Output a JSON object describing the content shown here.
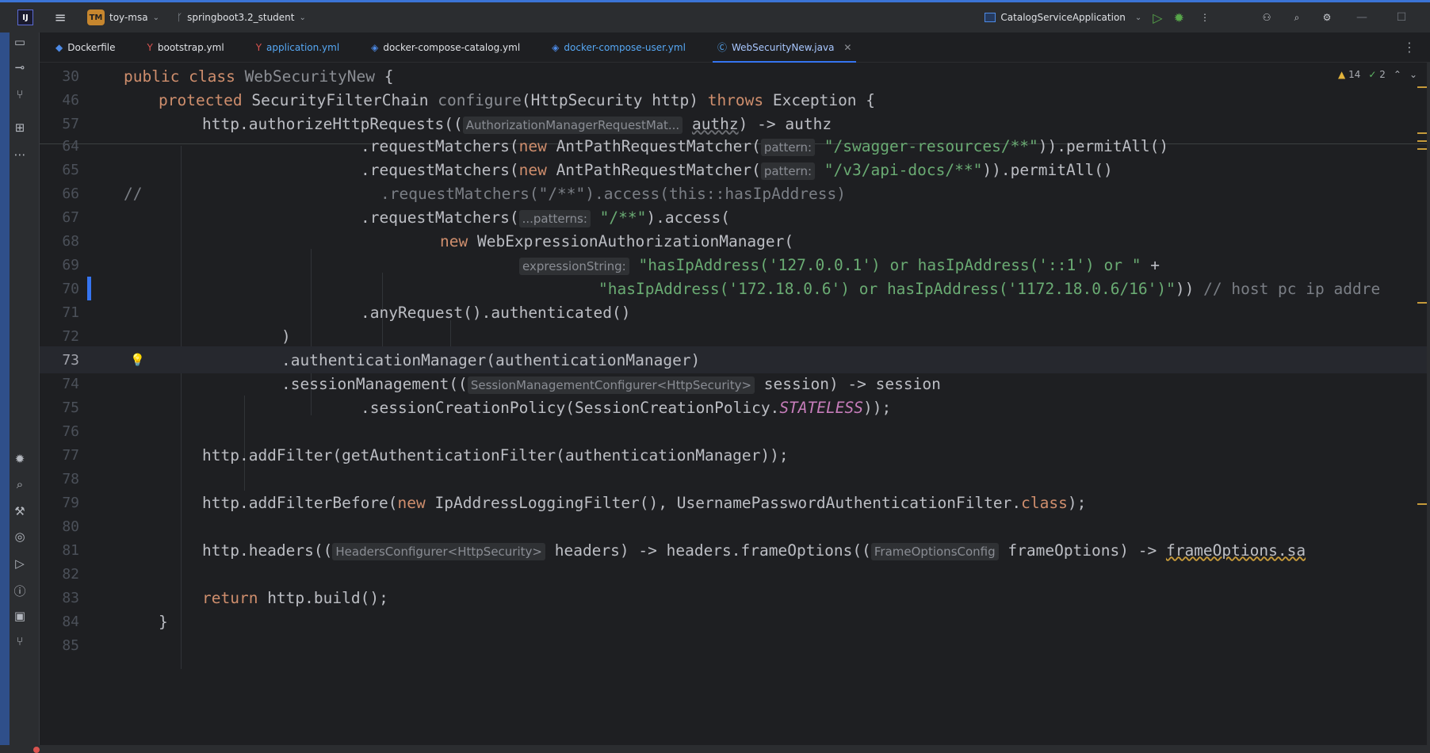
{
  "titlebar": {
    "app_logo": "IJ",
    "project_badge": "TM",
    "project_name": "toy-msa",
    "branch_name": "springboot3.2_student",
    "run_config": "CatalogServiceApplication"
  },
  "tabs": [
    {
      "label": "Dockerfile",
      "icon": "docker-icon",
      "color": "#bcbec4"
    },
    {
      "label": "bootstrap.yml",
      "icon": "yaml-icon",
      "color": "#bcbec4"
    },
    {
      "label": "application.yml",
      "icon": "yaml-icon",
      "color": "#56a8f5"
    },
    {
      "label": "docker-compose-catalog.yml",
      "icon": "docker-compose-icon",
      "color": "#bcbec4"
    },
    {
      "label": "docker-compose-user.yml",
      "icon": "docker-compose-icon",
      "color": "#56a8f5"
    },
    {
      "label": "WebSecurityNew.java",
      "icon": "java-class-icon",
      "color": "#a8c7ff",
      "active": true
    }
  ],
  "inspections": {
    "warnings": "14",
    "weak_warnings": "2"
  },
  "editor": {
    "lines": [
      {
        "n": "30"
      },
      {
        "n": "46"
      },
      {
        "n": "57"
      },
      {
        "n": "64"
      },
      {
        "n": "65"
      },
      {
        "n": "66"
      },
      {
        "n": "67"
      },
      {
        "n": "68"
      },
      {
        "n": "69"
      },
      {
        "n": "70"
      },
      {
        "n": "71"
      },
      {
        "n": "72"
      },
      {
        "n": "73"
      },
      {
        "n": "74"
      },
      {
        "n": "75"
      },
      {
        "n": "76"
      },
      {
        "n": "77"
      },
      {
        "n": "78"
      },
      {
        "n": "79"
      },
      {
        "n": "80"
      },
      {
        "n": "81"
      },
      {
        "n": "82"
      },
      {
        "n": "83"
      },
      {
        "n": "84"
      },
      {
        "n": "85"
      }
    ],
    "code": {
      "l30a": "public class ",
      "l30b": "WebSecurityNew",
      "l30c": " {",
      "l46a": "protected ",
      "l46b": "SecurityFilterChain ",
      "l46c": "configure",
      "l46d": "(HttpSecurity http) ",
      "l46e": "throws ",
      "l46f": "Exception {",
      "l57a": "http.authorizeHttpRequests((",
      "l57hint": "AuthorizationManagerRequestMat...",
      "l57b": "authz",
      "l57c": ") -> authz",
      "l64a": ".requestMatchers(",
      "l64b": "new ",
      "l64c": "AntPathRequestMatcher(",
      "l64hint": "pattern:",
      "l64d": "\"/swagger-resources/**\"",
      "l64e": ")).permitAll()",
      "l65a": ".requestMatchers(",
      "l65b": "new ",
      "l65c": "AntPathRequestMatcher(",
      "l65hint": "pattern:",
      "l65d": "\"/v3/api-docs/**\"",
      "l65e": ")).permitAll()",
      "l66a": "//",
      "l66b": ".requestMatchers(\"/**\").access(this::hasIpAddress)",
      "l67a": ".requestMatchers(",
      "l67hint": "...patterns:",
      "l67b": "\"/**\"",
      "l67c": ").access(",
      "l68a": "new ",
      "l68b": "WebExpressionAuthorizationManager(",
      "l69hint": "expressionString:",
      "l69a": "\"hasIpAddress('127.0.0.1') or hasIpAddress('::1') or \"",
      "l69b": " +",
      "l70a": "\"hasIpAddress('172.18.0.6') or hasIpAddress('1172.18.0.6/16')\"",
      "l70b": ")) ",
      "l70c": "// host pc ip addre",
      "l71a": ".anyRequest().authenticated()",
      "l72a": ")",
      "l73a": ".authenticationManager(authenticationManager)",
      "l74a": ".sessionManagement((",
      "l74hint": "SessionManagementConfigurer<HttpSecurity>",
      "l74b": " session) -> session",
      "l75a": ".sessionCreationPolicy(SessionCreationPolicy.",
      "l75b": "STATELESS",
      "l75c": "));",
      "l77a": "http.addFilter(getAuthenticationFilter(authenticationManager));",
      "l79a": "http.addFilterBefore(",
      "l79b": "new ",
      "l79c": "IpAddressLoggingFilter(), UsernamePasswordAuthenticationFilter.",
      "l79d": "class",
      "l79e": ");",
      "l81a": "http.headers((",
      "l81hint": "HeadersConfigurer<HttpSecurity>",
      "l81b": " headers) -> headers.frameOptions((",
      "l81hint2": "FrameOptionsConfig",
      "l81c": " frameOptions) -> ",
      "l81d": "frameOptions.sa",
      "l83a": "return ",
      "l83b": "http.build();",
      "l84a": "}"
    }
  }
}
